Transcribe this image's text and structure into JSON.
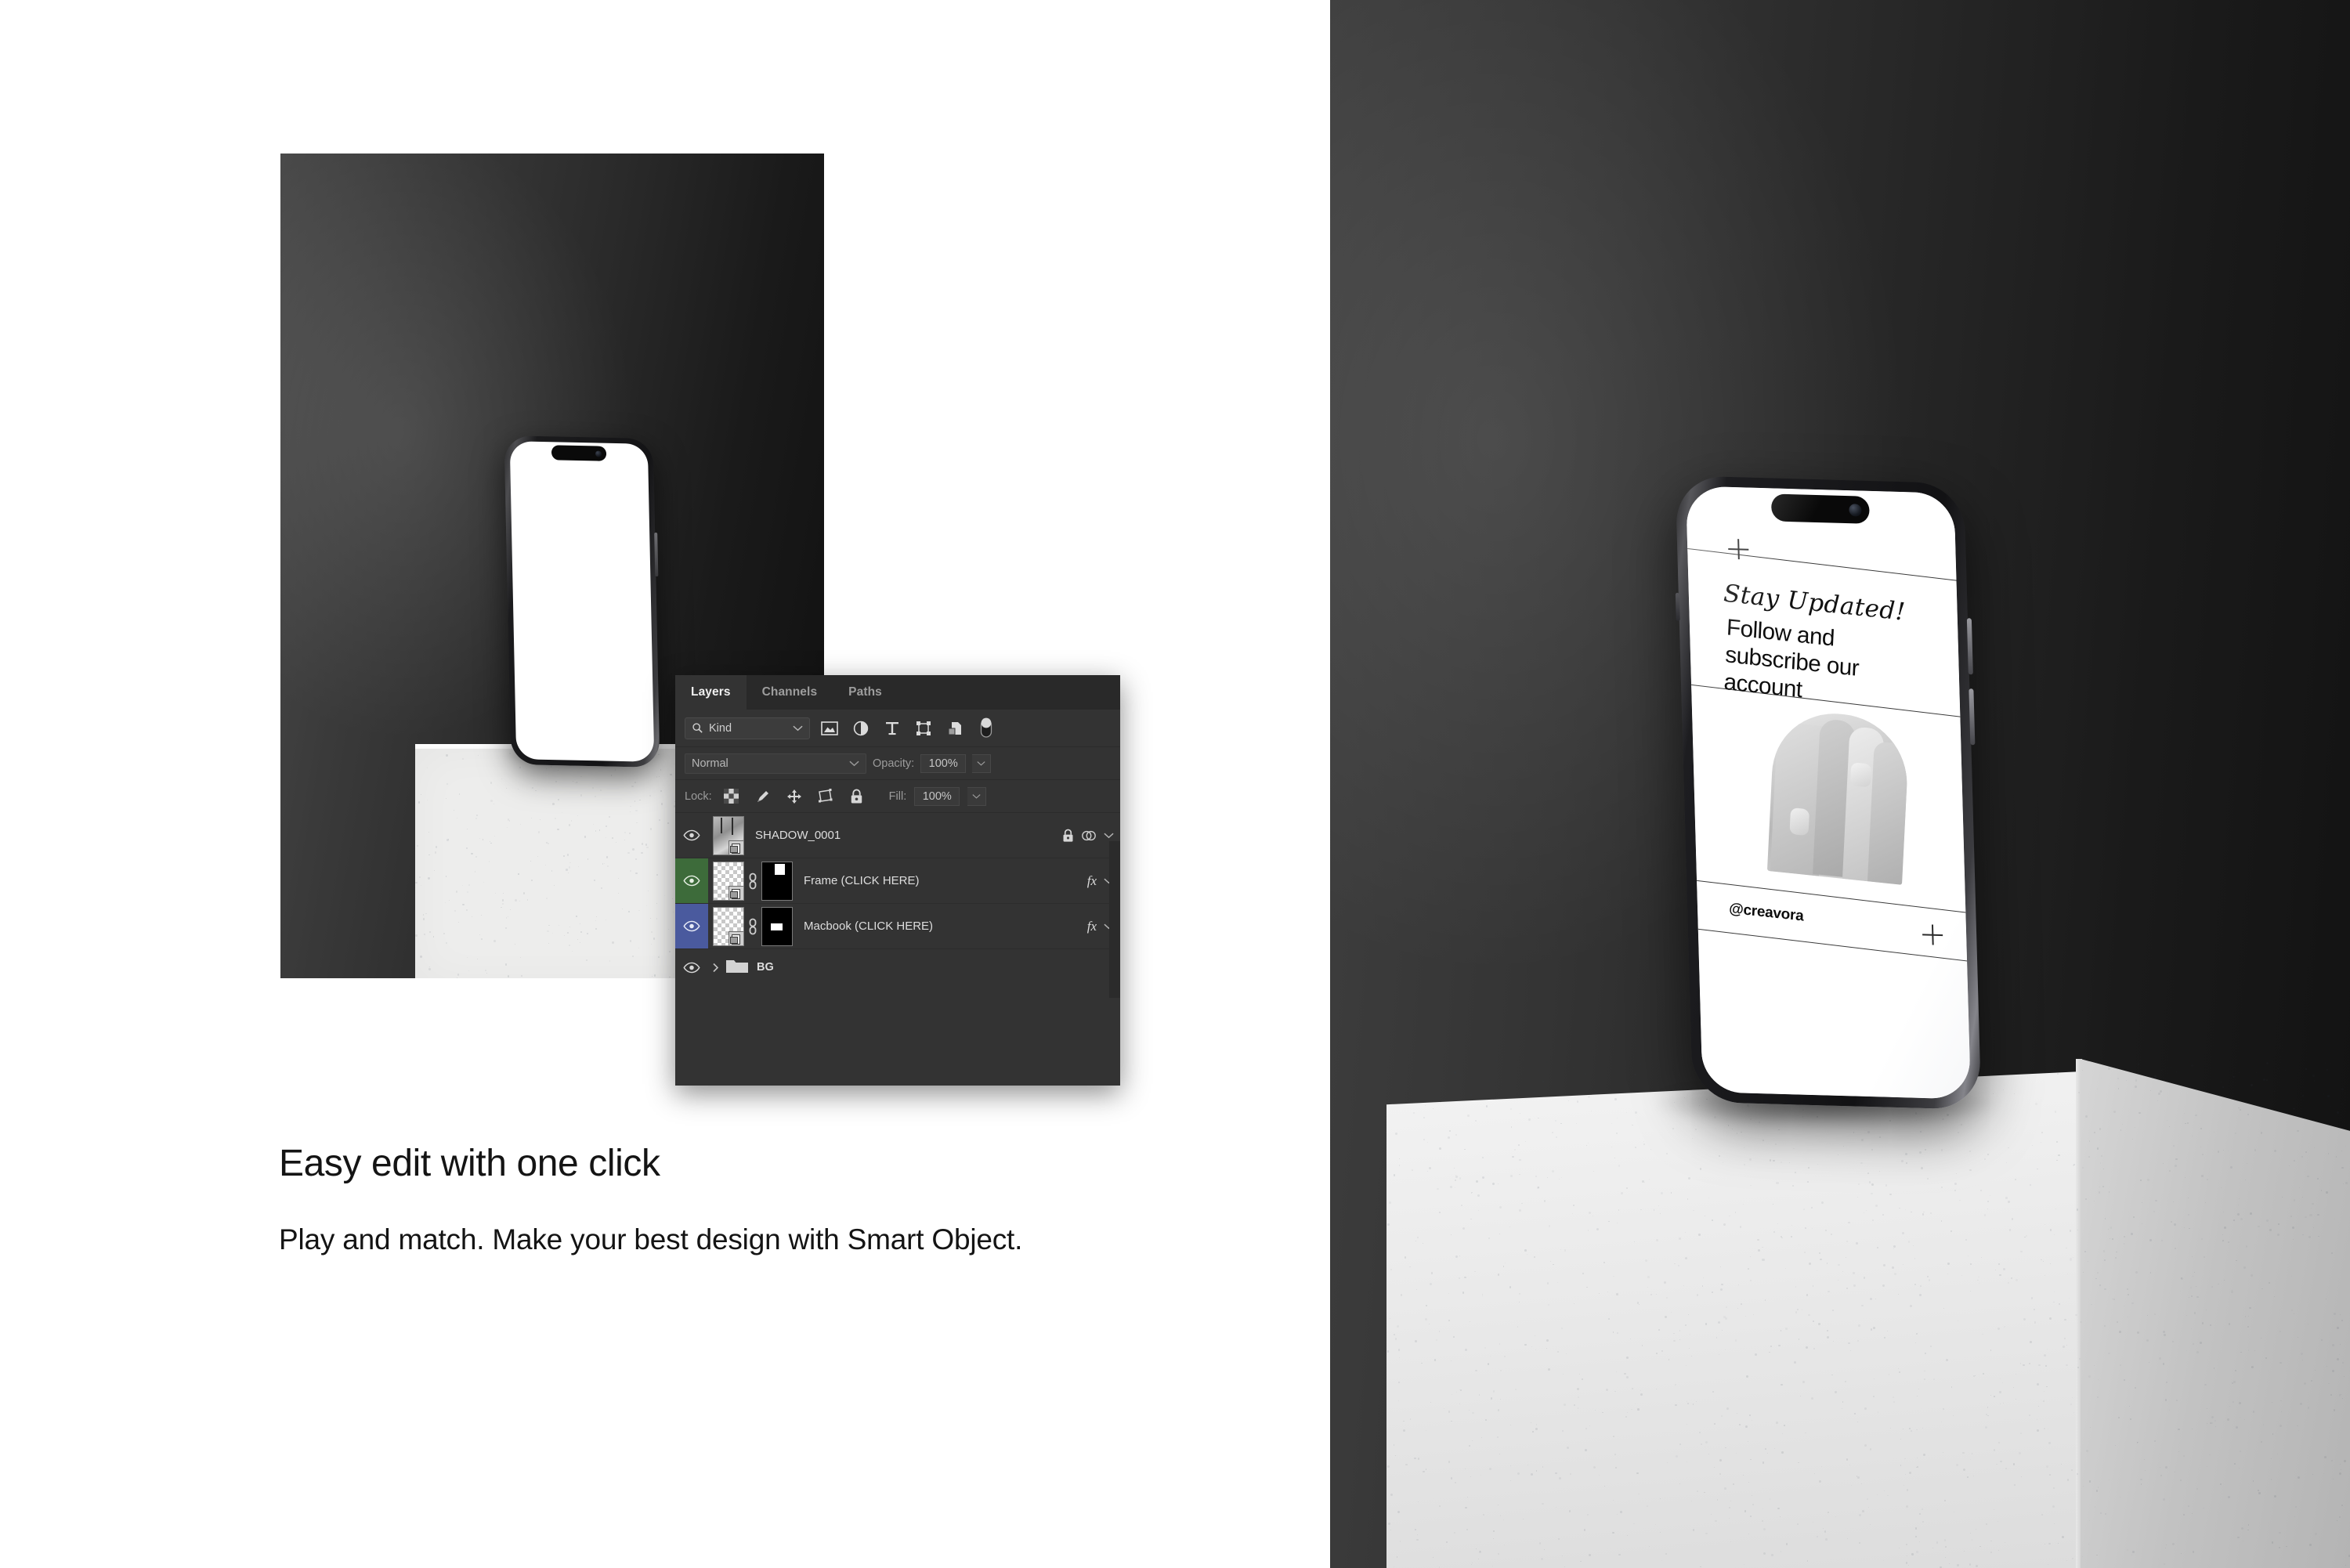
{
  "caption": {
    "title": "Easy edit with one click",
    "body": "Play and match. Make your best design with Smart Object."
  },
  "photoshop_panel": {
    "tabs": [
      {
        "label": "Layers",
        "active": true
      },
      {
        "label": "Channels",
        "active": false
      },
      {
        "label": "Paths",
        "active": false
      }
    ],
    "filter_row": {
      "search_icon": "search-icon",
      "kind_label": "Kind",
      "chevron": "chevron-down-icon",
      "filter_icons": [
        "pixel-layer-filter-icon",
        "adjustment-layer-filter-icon",
        "type-layer-filter-icon",
        "shape-layer-filter-icon",
        "smart-object-filter-icon"
      ],
      "toggle": "filter-enable-toggle"
    },
    "blend_row": {
      "blend_mode": "Normal",
      "opacity_label": "Opacity:",
      "opacity_value": "100%"
    },
    "lock_row": {
      "lock_label": "Lock:",
      "lock_icons": [
        "lock-transparent-pixels-icon",
        "lock-image-pixels-icon",
        "lock-position-icon",
        "lock-artboard-nesting-icon",
        "lock-all-icon"
      ],
      "fill_label": "Fill:",
      "fill_value": "100%"
    },
    "layers": [
      {
        "name": "SHADOW_0001",
        "visible": true,
        "highlight": "none",
        "has_mask": false,
        "has_link": false,
        "fx": "",
        "lock_icon": "lock-icon",
        "extra_icon": "layer-style-circles-icon",
        "chevron": "chevron-down-icon"
      },
      {
        "name": "Frame (CLICK HERE)",
        "visible": true,
        "highlight": "green",
        "has_mask": true,
        "has_link": true,
        "fx": "fx",
        "chevron": "chevron-down-icon"
      },
      {
        "name": "Macbook (CLICK HERE)",
        "visible": true,
        "highlight": "blue",
        "has_mask": true,
        "has_link": true,
        "fx": "fx",
        "chevron": "chevron-down-icon"
      },
      {
        "name": "BG",
        "visible": true,
        "highlight": "none",
        "is_group": true,
        "has_mask": false,
        "has_link": false,
        "fx": "",
        "chevron": "chevron-right-icon"
      }
    ],
    "colors": {
      "panel_bg": "#333333",
      "tab_bar_bg": "#292929",
      "green_highlight": "#3d6b3a",
      "blue_highlight": "#4a5a9e",
      "text": "#dedede"
    }
  },
  "phone_mockup_left": {
    "screen_state": "blank-white",
    "island": "dynamic-island"
  },
  "phone_mockup_right": {
    "island": "dynamic-island",
    "design": {
      "headline": "Stay Updated!",
      "subheadline": "Follow and subscribe our account",
      "handle": "@creavora"
    }
  },
  "scene": {
    "backdrop_gradient_from": "#3f3f3f",
    "backdrop_gradient_to": "#121212",
    "podium_color": "#ededec"
  }
}
